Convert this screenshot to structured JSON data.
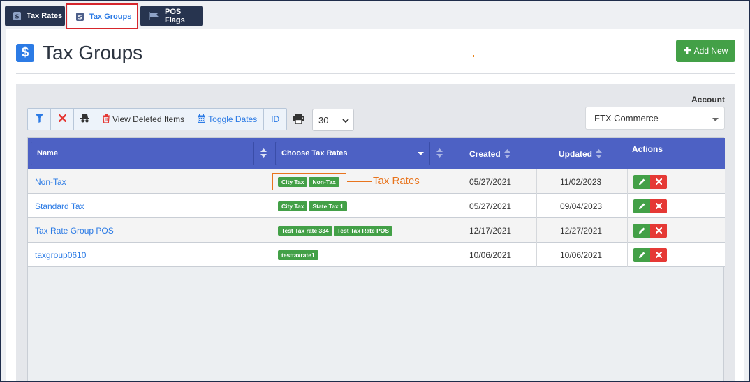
{
  "tabs": [
    {
      "label": "Tax Rates",
      "icon": "dollar-icon"
    },
    {
      "label": "Tax Groups",
      "icon": "dollar-icon",
      "active": true
    },
    {
      "label": "POS Flags",
      "icon": "flag-icon"
    }
  ],
  "page": {
    "title": "Tax Groups",
    "add_label": "Add New"
  },
  "toolbar": {
    "view_deleted_label": "View Deleted Items",
    "toggle_dates_label": "Toggle Dates",
    "id_label": "ID",
    "page_size": "30"
  },
  "account": {
    "label": "Account",
    "value": "FTX Commerce"
  },
  "table": {
    "headers": {
      "name": "Name",
      "tax_rates": "Choose Tax Rates",
      "created": "Created",
      "updated": "Updated",
      "actions": "Actions"
    },
    "rows": [
      {
        "name": "Non-Tax",
        "rates": [
          "City Tax",
          "Non-Tax"
        ],
        "created": "05/27/2021",
        "updated": "11/02/2023"
      },
      {
        "name": "Standard Tax",
        "rates": [
          "City Tax",
          "State Tax 1"
        ],
        "created": "05/27/2021",
        "updated": "09/04/2023"
      },
      {
        "name": "Tax Rate Group POS",
        "rates": [
          "Test Tax rate 334",
          "Test Tax Rate POS"
        ],
        "created": "12/17/2021",
        "updated": "12/27/2021"
      },
      {
        "name": "taxgroup0610",
        "rates": [
          "testtaxrate1"
        ],
        "created": "10/06/2021",
        "updated": "10/06/2021"
      }
    ]
  },
  "annotation": {
    "text": "Tax Rates",
    "color": "#e8741d"
  },
  "colors": {
    "header": "#4d61c4",
    "accent": "#2c7be5",
    "success": "#43a047",
    "danger": "#e53935",
    "tab_dark": "#27344f"
  }
}
